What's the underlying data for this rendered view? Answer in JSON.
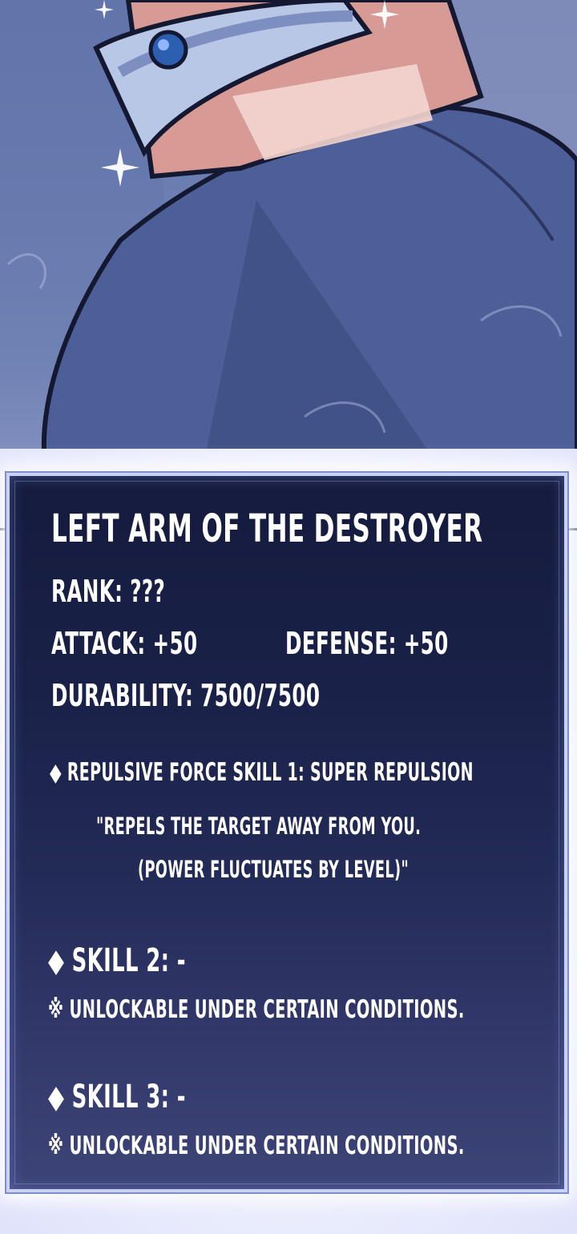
{
  "item": {
    "title": "LEFT ARM OF THE DESTROYER",
    "rank": "RANK: ???",
    "attack": "ATTACK: +50",
    "defense": "DEFENSE: +50",
    "durability": "DURABILITY: 7500/7500"
  },
  "skills": [
    {
      "heading": "◆ REPULSIVE FORCE SKILL 1: SUPER REPULSION",
      "desc_line1": "\"REPELS THE TARGET AWAY FROM YOU.",
      "desc_line2": "(POWER FLUCTUATES BY LEVEL)\""
    },
    {
      "heading": "◆  SKILL 2: -",
      "note": "※ UNLOCKABLE UNDER CERTAIN CONDITIONS."
    },
    {
      "heading": "◆ SKILL 3: -",
      "note": "※ UNLOCKABLE UNDER CERTAIN CONDITIONS."
    }
  ],
  "colors": {
    "panel_top": "#151b3e",
    "panel_bottom": "#3d4477",
    "panel_border": "#c9d2f2",
    "text": "#ffffff",
    "sleeve": "#4c5f98",
    "skin": "#d79a95"
  }
}
